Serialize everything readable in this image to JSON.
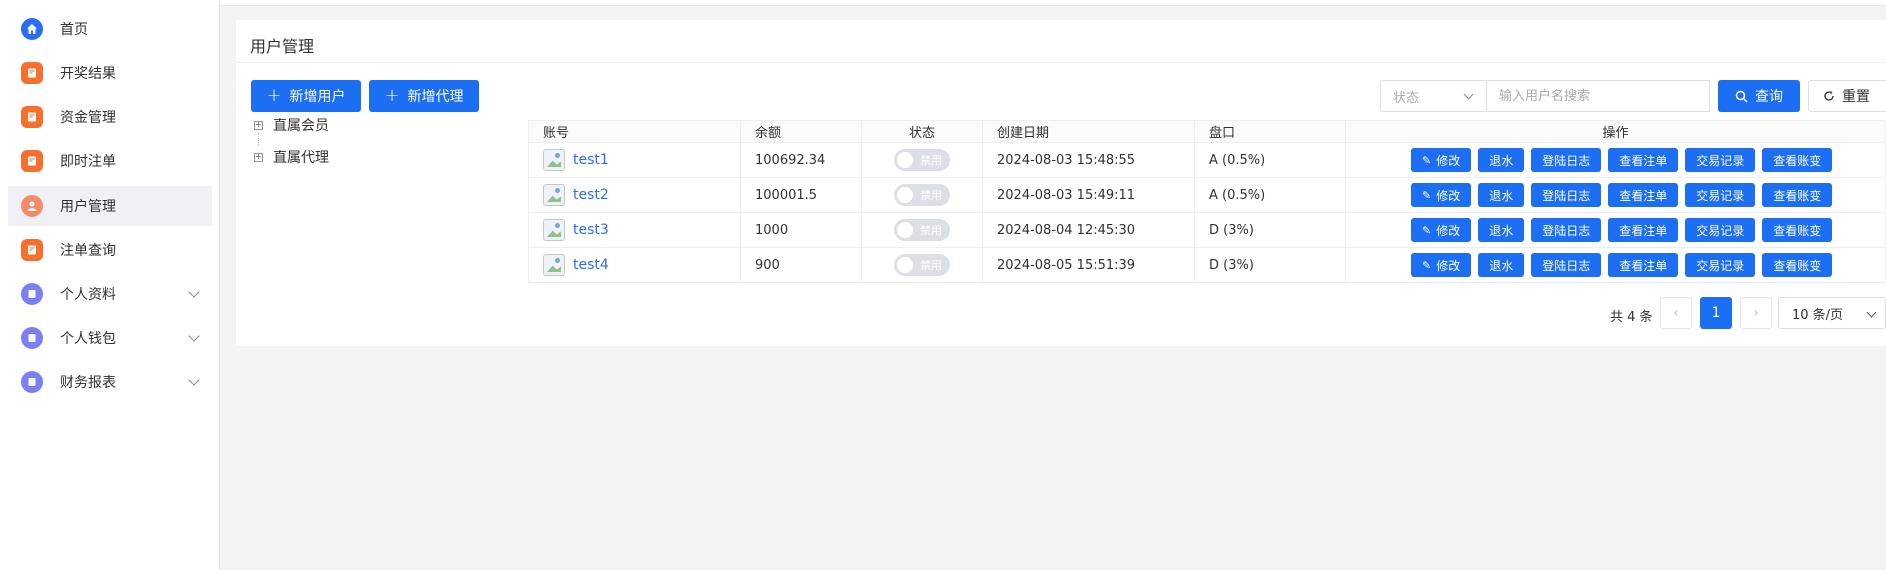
{
  "sidebar": {
    "items": [
      {
        "label": "首页",
        "icon": "home-icon",
        "color": "#2a6df4"
      },
      {
        "label": "开奖结果",
        "icon": "document-icon",
        "color": "#f6702d"
      },
      {
        "label": "资金管理",
        "icon": "document-icon",
        "color": "#f6702d"
      },
      {
        "label": "即时注单",
        "icon": "document-icon",
        "color": "#f6702d"
      },
      {
        "label": "用户管理",
        "icon": "user-icon",
        "color": "#f7896b",
        "active": true
      },
      {
        "label": "注单查询",
        "icon": "document-icon",
        "color": "#f6702d"
      },
      {
        "label": "个人资料",
        "icon": "profile-icon",
        "color": "#7b7ff4",
        "expandable": true
      },
      {
        "label": "个人钱包",
        "icon": "wallet-icon",
        "color": "#7b7ff4",
        "expandable": true
      },
      {
        "label": "财务报表",
        "icon": "report-icon",
        "color": "#7b7ff4",
        "expandable": true
      }
    ]
  },
  "page": {
    "title": "用户管理",
    "add_user_label": "新增用户",
    "add_agent_label": "新增代理"
  },
  "filter": {
    "status_placeholder": "状态",
    "search_placeholder": "输入用户名搜索",
    "search_label": "查询",
    "reset_label": "重置"
  },
  "tree": {
    "nodes": [
      "直属会员",
      "直属代理"
    ]
  },
  "table": {
    "columns": [
      "账号",
      "余额",
      "状态",
      "创建日期",
      "盘口",
      "操作"
    ],
    "status_text": "禁用",
    "actions": [
      "修改",
      "退水",
      "登陆日志",
      "查看注单",
      "交易记录",
      "查看账变"
    ],
    "rows": [
      {
        "account": "test1",
        "balance": "100692.34",
        "created": "2024-08-03 15:48:55",
        "pankou": "A (0.5%)"
      },
      {
        "account": "test2",
        "balance": "100001.5",
        "created": "2024-08-03 15:49:11",
        "pankou": "A (0.5%)"
      },
      {
        "account": "test3",
        "balance": "1000",
        "created": "2024-08-04 12:45:30",
        "pankou": "D (3%)"
      },
      {
        "account": "test4",
        "balance": "900",
        "created": "2024-08-05 15:51:39",
        "pankou": "D (3%)"
      }
    ]
  },
  "pagination": {
    "total_text": "共 4 条",
    "prev": "‹",
    "current_page": "1",
    "next": "›",
    "page_size": "10 条/页"
  },
  "colors": {
    "primary": "#1c6ef2",
    "accent_orange": "#f6702d",
    "accent_purple": "#7b7ff4"
  }
}
